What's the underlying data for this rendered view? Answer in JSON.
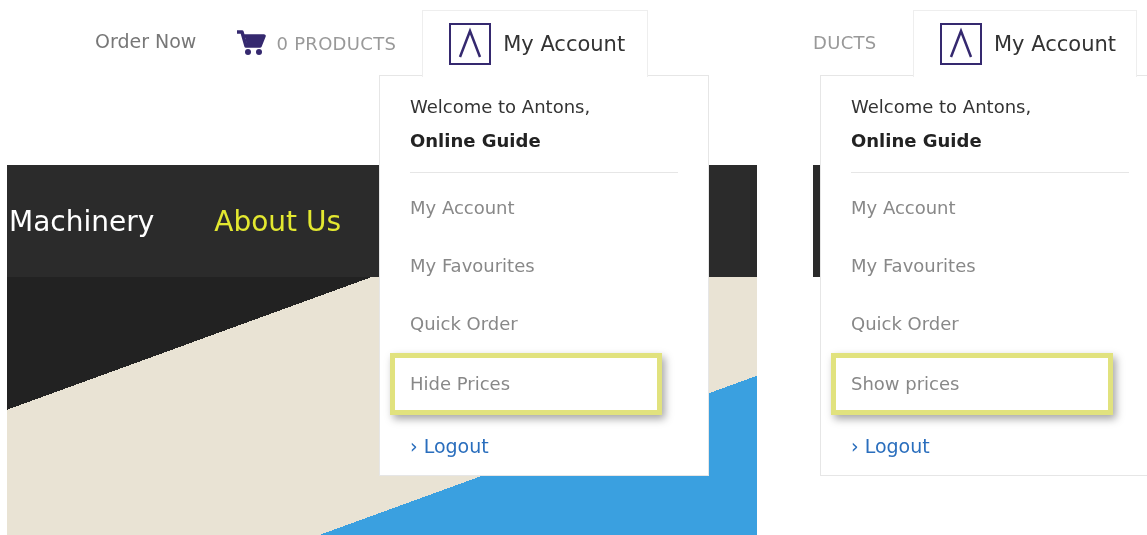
{
  "panels": [
    {
      "kind": "full",
      "header": {
        "order_now": "Order Now",
        "cart": "0 PRODUCTS",
        "account": "My Account"
      },
      "nav": [
        {
          "label": "Machinery",
          "selected": false
        },
        {
          "label": "About Us",
          "selected": true
        }
      ],
      "dropdown": {
        "welcome": "Welcome to Antons,",
        "name": "Online Guide",
        "items": [
          {
            "label": "My Account",
            "highlighted": false
          },
          {
            "label": "My Favourites",
            "highlighted": false
          },
          {
            "label": "Quick Order",
            "highlighted": false
          },
          {
            "label": "Hide Prices",
            "highlighted": true
          }
        ],
        "logout_mark": "›",
        "logout": "Logout"
      }
    },
    {
      "kind": "cropped",
      "header": {
        "cart": "DUCTS",
        "account": "My Account"
      },
      "dropdown": {
        "welcome": "Welcome to Antons,",
        "name": "Online Guide",
        "items": [
          {
            "label": "My Account",
            "highlighted": false
          },
          {
            "label": "My Favourites",
            "highlighted": false
          },
          {
            "label": "Quick Order",
            "highlighted": false
          },
          {
            "label": "Show prices",
            "highlighted": true
          }
        ],
        "logout_mark": "›",
        "logout": "Logout"
      }
    }
  ]
}
